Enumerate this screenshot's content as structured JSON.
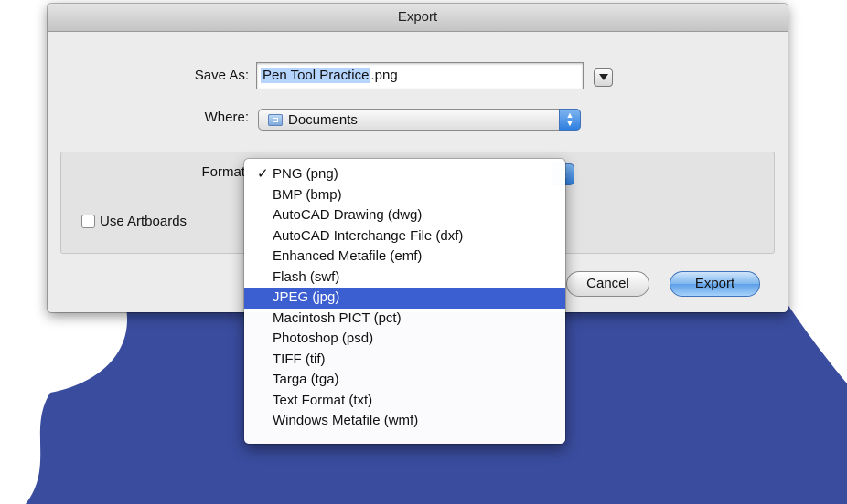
{
  "dialog": {
    "title": "Export",
    "save_as_label": "Save As:",
    "filename_selected": "Pen Tool Practice",
    "filename_ext": ".png",
    "where_label": "Where:",
    "where_value": "Documents",
    "format_label": "Format",
    "use_artboards_label": "Use Artboards",
    "use_artboards_checked": false,
    "cancel_label": "Cancel",
    "export_label": "Export"
  },
  "format_menu": {
    "checkmark": "✓",
    "selected_index": 0,
    "highlighted_index": 6,
    "items": [
      "PNG (png)",
      "BMP (bmp)",
      "AutoCAD Drawing (dwg)",
      "AutoCAD Interchange File (dxf)",
      "Enhanced Metafile (emf)",
      "Flash (swf)",
      "JPEG (jpg)",
      "Macintosh PICT (pct)",
      "Photoshop (psd)",
      "TIFF (tif)",
      "Targa (tga)",
      "Text Format (txt)",
      "Windows Metafile (wmf)"
    ]
  },
  "icons": {
    "disclosure": "chevron-down-icon",
    "folder": "folder-icon",
    "popup_arrows": "updown-arrows-icon"
  },
  "colors": {
    "background_shape": "#3a4c9e",
    "menu_highlight": "#3b5fd1",
    "text_selection": "#b5d5ff",
    "default_button": "#5d9fe8"
  }
}
